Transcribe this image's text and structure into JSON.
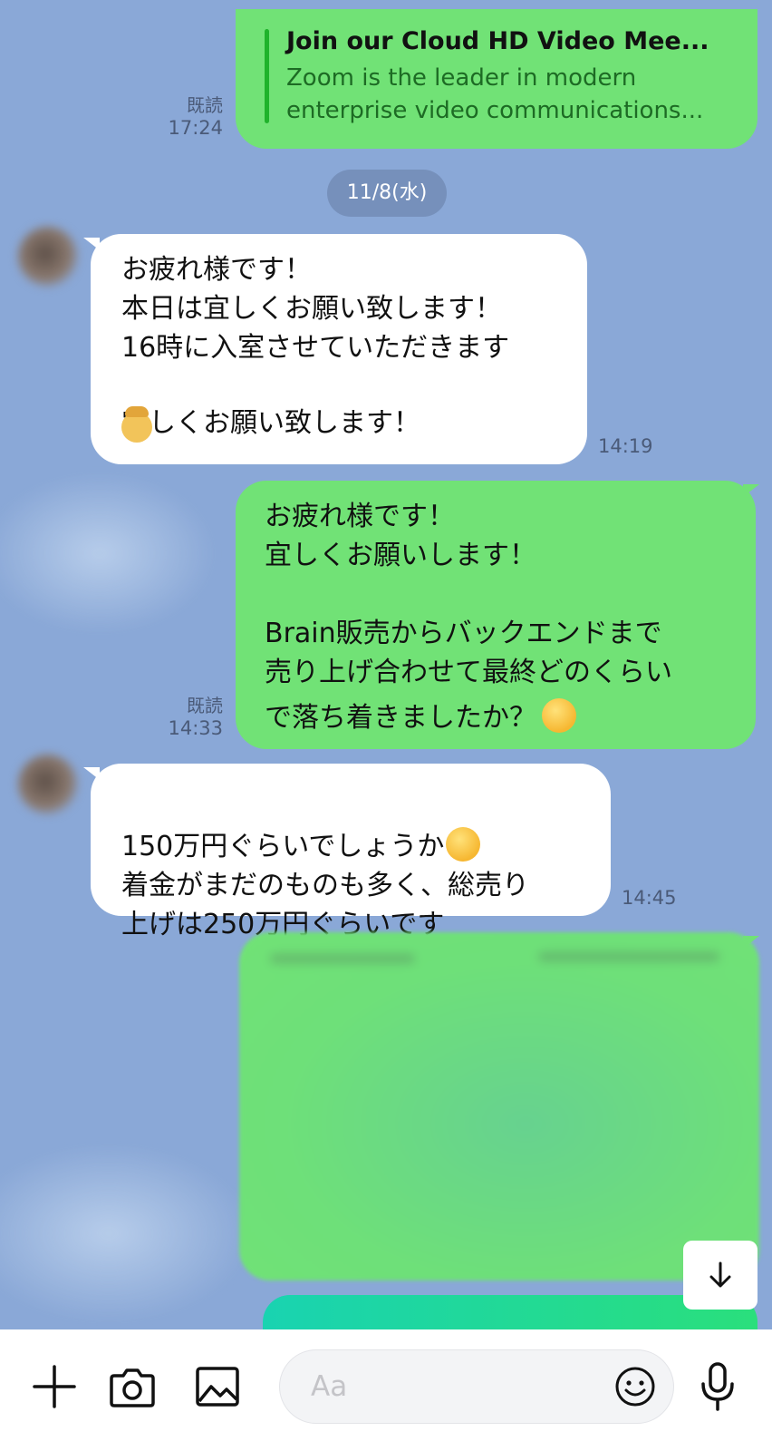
{
  "header_message": {
    "read_label": "既読",
    "time": "17:24",
    "link_title": "Join our Cloud HD Video Mee...",
    "link_description": "Zoom is the leader in modern\nenterprise video communications..."
  },
  "date_separator": "11/8(水)",
  "messages": [
    {
      "direction": "in",
      "text_before_emoji": "お疲れ様です！\n本日は宜しくお願い致します！\n16時に入室させていただきます",
      "emoji": "person-bowing-emoji",
      "text_after_emoji": "宜しくお願い致します！",
      "time": "14:19"
    },
    {
      "direction": "out",
      "read_label": "既読",
      "text": "お疲れ様です！\n宜しくお願いします！\n\nBrain販売からバックエンドまで\n売り上げ合わせて最終どのくらい\nで落ち着きましたか？",
      "emoji": "relieved-face-emoji",
      "time": "14:33"
    },
    {
      "direction": "in",
      "line1": "150万円ぐらいでしょうか",
      "emoji": "thinking-face-emoji",
      "rest": "着金がまだのものも多く、総売り\n上げは250万円ぐらいです",
      "time": "14:45"
    }
  ],
  "composer": {
    "placeholder": "Aa",
    "icons": [
      "plus-icon",
      "camera-icon",
      "image-icon",
      "emoji-icon",
      "microphone-icon"
    ]
  },
  "colors": {
    "background": "#8aa8d7",
    "outgoing_bubble": "#71e276",
    "incoming_bubble": "#ffffff"
  }
}
